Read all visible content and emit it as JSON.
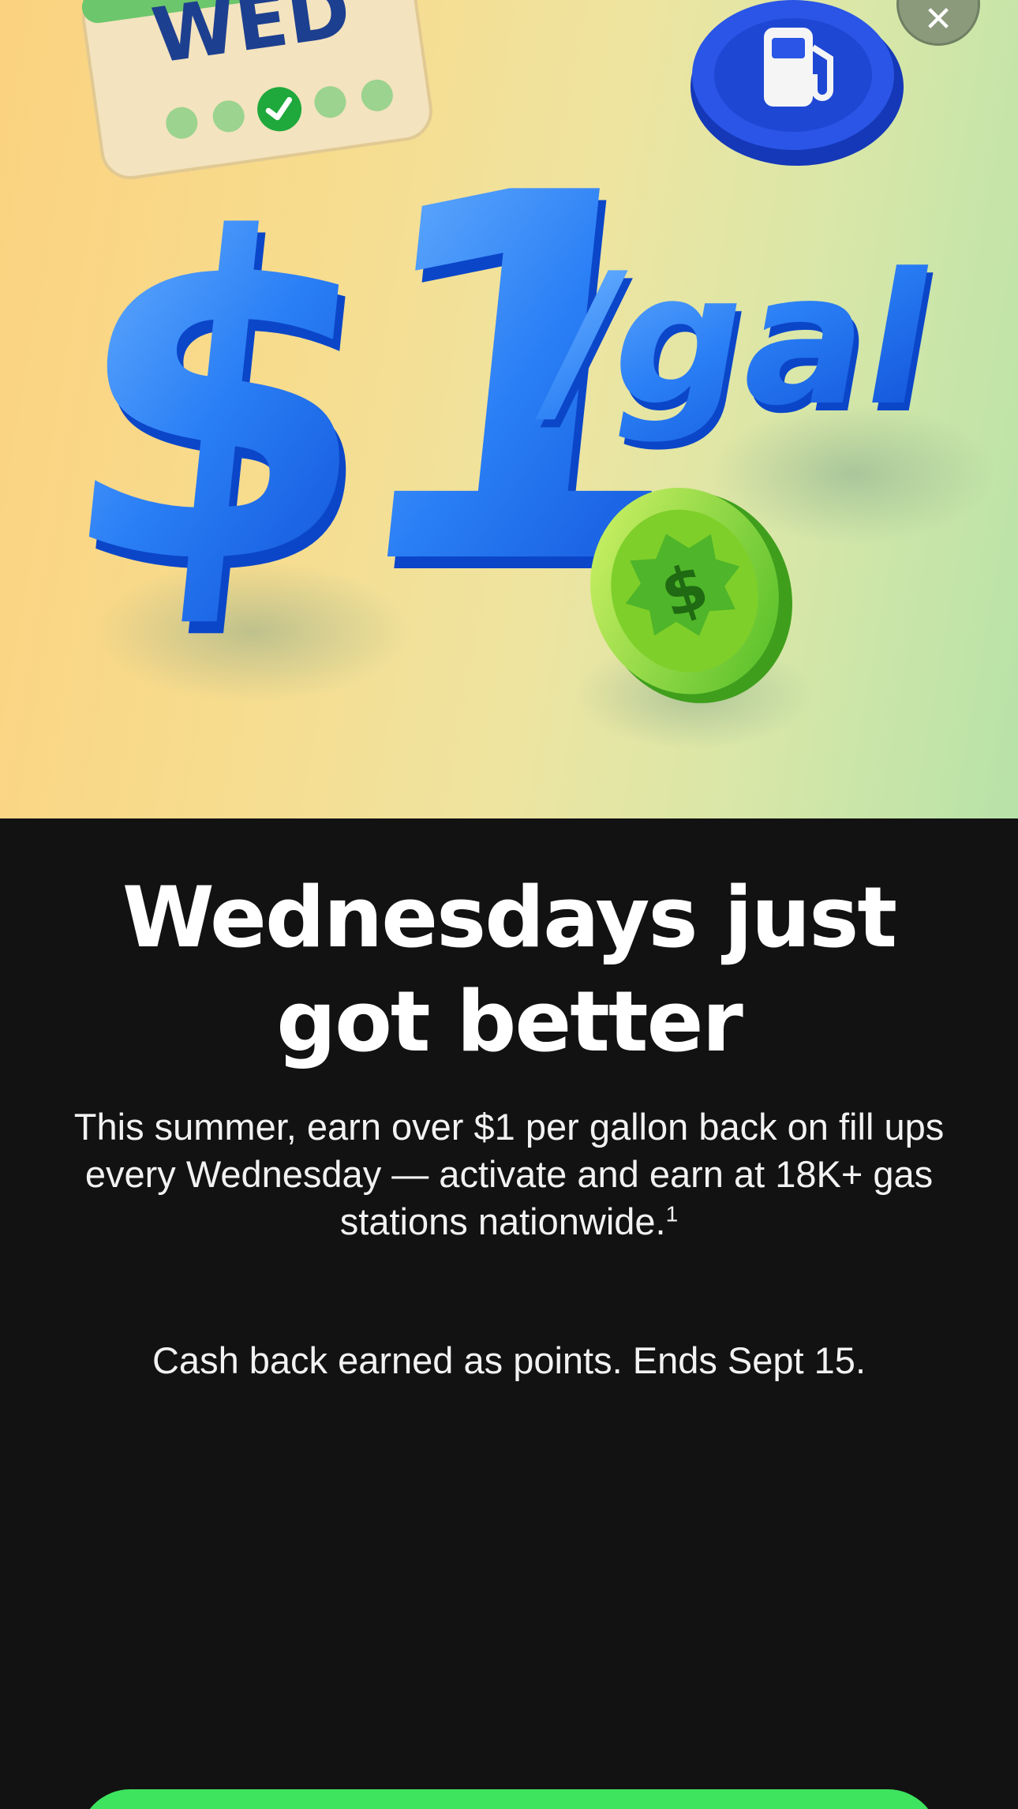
{
  "hero": {
    "calendar_day": "WED",
    "price_dollar": "$",
    "price_amount": "1",
    "price_unit": "/gal",
    "coin_symbol": "$",
    "icons": [
      "calendar-icon",
      "gas-pump-icon",
      "dollar-coin-icon"
    ]
  },
  "close_button": {
    "glyph": "✕"
  },
  "content": {
    "headline_line1": "Wednesdays just",
    "headline_line2": "got better",
    "body": "This summer, earn over $1 per gallon back on fill ups every Wednesday — activate and earn at 18K+ gas stations nationwide.",
    "body_footnote": "1",
    "terms": "Cash back earned as points. Ends Sept 15."
  },
  "colors": {
    "background": "#121212",
    "accent_green": "#3ee35e",
    "hero_blue": "#1f6ff0",
    "coin_green": "#8fd62c"
  }
}
